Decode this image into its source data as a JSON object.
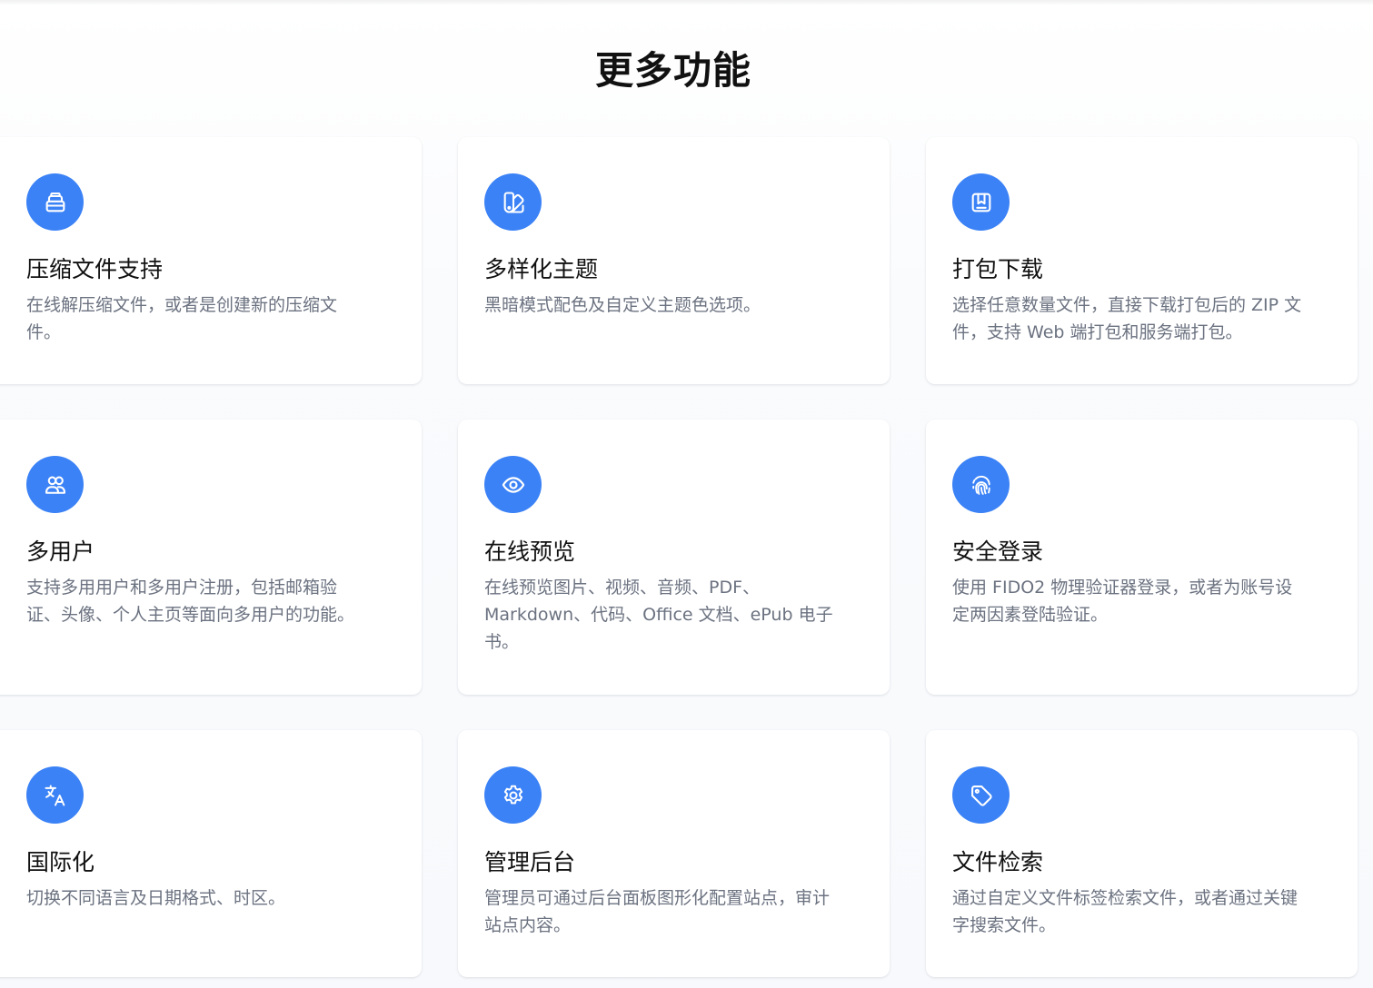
{
  "section": {
    "title": "更多功能"
  },
  "features": [
    {
      "title": "压缩文件支持",
      "description": "在线解压缩文件，或者是创建新的压缩文件。",
      "icon": "archive-icon"
    },
    {
      "title": "多样化主题",
      "description": "黑暗模式配色及自定义主题色选项。",
      "icon": "color-swatch-icon"
    },
    {
      "title": "打包下载",
      "description": "选择任意数量文件，直接下载打包后的 ZIP 文件，支持 Web 端打包和服务端打包。",
      "icon": "package-icon"
    },
    {
      "title": "多用户",
      "description": "支持多用用户和多用户注册，包括邮箱验证、头像、个人主页等面向多用户的功能。",
      "icon": "users-icon"
    },
    {
      "title": "在线预览",
      "description": "在线预览图片、视频、音频、PDF、Markdown、代码、Office 文档、ePub 电子书。",
      "icon": "eye-icon"
    },
    {
      "title": "安全登录",
      "description": "使用 FIDO2 物理验证器登录，或者为账号设定两因素登陆验证。",
      "icon": "fingerprint-icon"
    },
    {
      "title": "国际化",
      "description": "切换不同语言及日期格式、时区。",
      "icon": "translate-icon"
    },
    {
      "title": "管理后台",
      "description": "管理员可通过后台面板图形化配置站点，审计站点内容。",
      "icon": "gear-icon"
    },
    {
      "title": "文件检索",
      "description": "通过自定义文件标签检索文件，或者通过关键字搜索文件。",
      "icon": "tag-icon"
    }
  ],
  "colors": {
    "accent": "#3b82f6",
    "title_text": "#111111",
    "description_text": "#6b7280",
    "card_background": "#ffffff"
  }
}
